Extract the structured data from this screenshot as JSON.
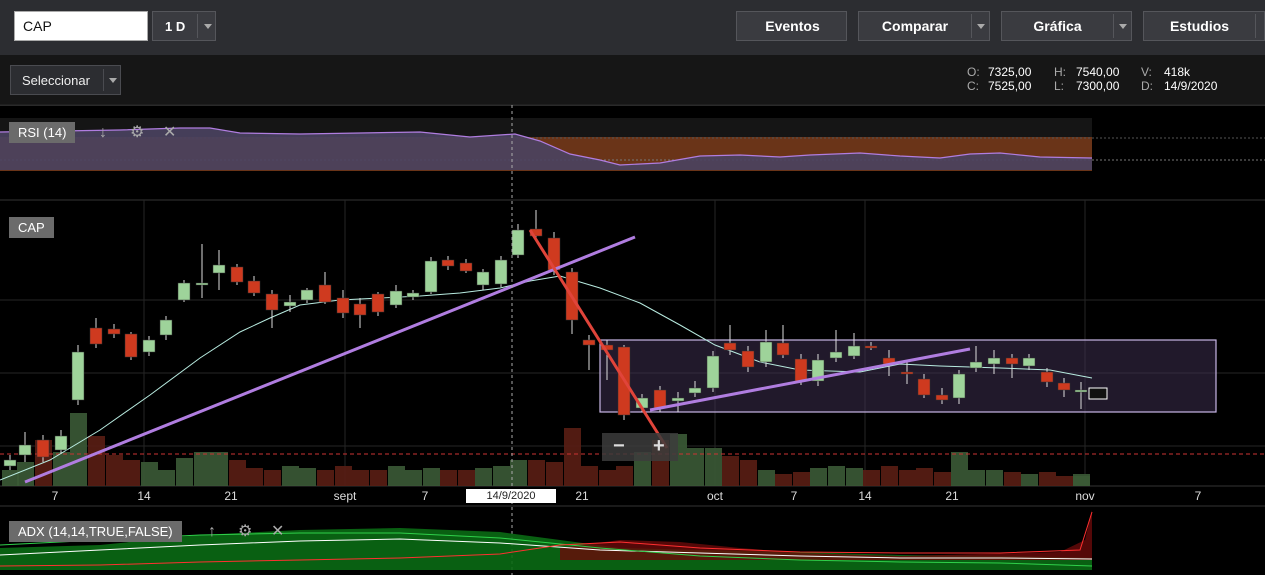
{
  "toolbar": {
    "symbol": "CAP",
    "interval": "1 D",
    "buttons": {
      "events": "Eventos",
      "compare": "Comparar",
      "chart": "Gráfica",
      "studies": "Estudios"
    }
  },
  "subbar": {
    "select_label": "Seleccionar",
    "ohlc": {
      "o_label": "O:",
      "o": "7325,00",
      "h_label": "H:",
      "h": "7540,00",
      "v_label": "V:",
      "v": "418k",
      "c_label": "C:",
      "c": "7525,00",
      "l_label": "L:",
      "l": "7300,00",
      "d_label": "D:",
      "d": "14/9/2020"
    }
  },
  "panes": {
    "rsi_label": "RSI (14)",
    "main_label": "CAP",
    "adx_label": "ADX (14,14,TRUE,FALSE)"
  },
  "x_axis": {
    "labels": [
      "7",
      "14",
      "21",
      "sept",
      "7",
      "21",
      "oct",
      "7",
      "14",
      "21",
      "nov",
      "7"
    ],
    "crosshair_date": "14/9/2020"
  },
  "icons": {
    "arrow_down": "↓",
    "gear": "⚙",
    "close": "✕",
    "arrow_up": "↑",
    "minus": "−",
    "plus": "+"
  },
  "colors": {
    "up": "#9ed39a",
    "down": "#cf3a1f",
    "trendline": "#b07de0",
    "redline": "#e0443a",
    "rsi_band": "#6a3418",
    "ma": "#b8ebe0"
  }
}
